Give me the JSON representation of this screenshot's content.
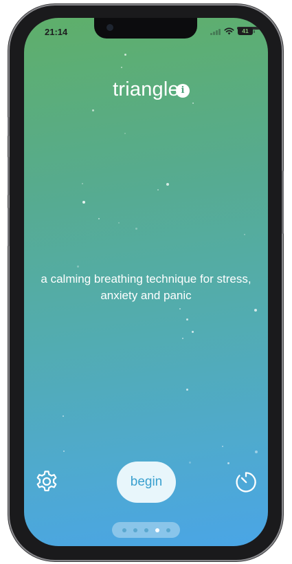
{
  "status_bar": {
    "time": "21:14",
    "battery_level": "41"
  },
  "screen": {
    "title": "triangle",
    "info_icon": "info-icon",
    "description_line1": "a calming breathing technique for stress,",
    "description_line2": "anxiety and panic"
  },
  "controls": {
    "begin_label": "begin",
    "settings_icon": "gear-icon",
    "timer_icon": "timer-icon"
  },
  "page_indicator": {
    "count": 5,
    "active_index": 3
  },
  "colors": {
    "gradient_top": "#5faf6a",
    "gradient_bottom": "#4aa5e6",
    "begin_text": "#3aa0cf",
    "begin_background": "#e8f6fb"
  }
}
